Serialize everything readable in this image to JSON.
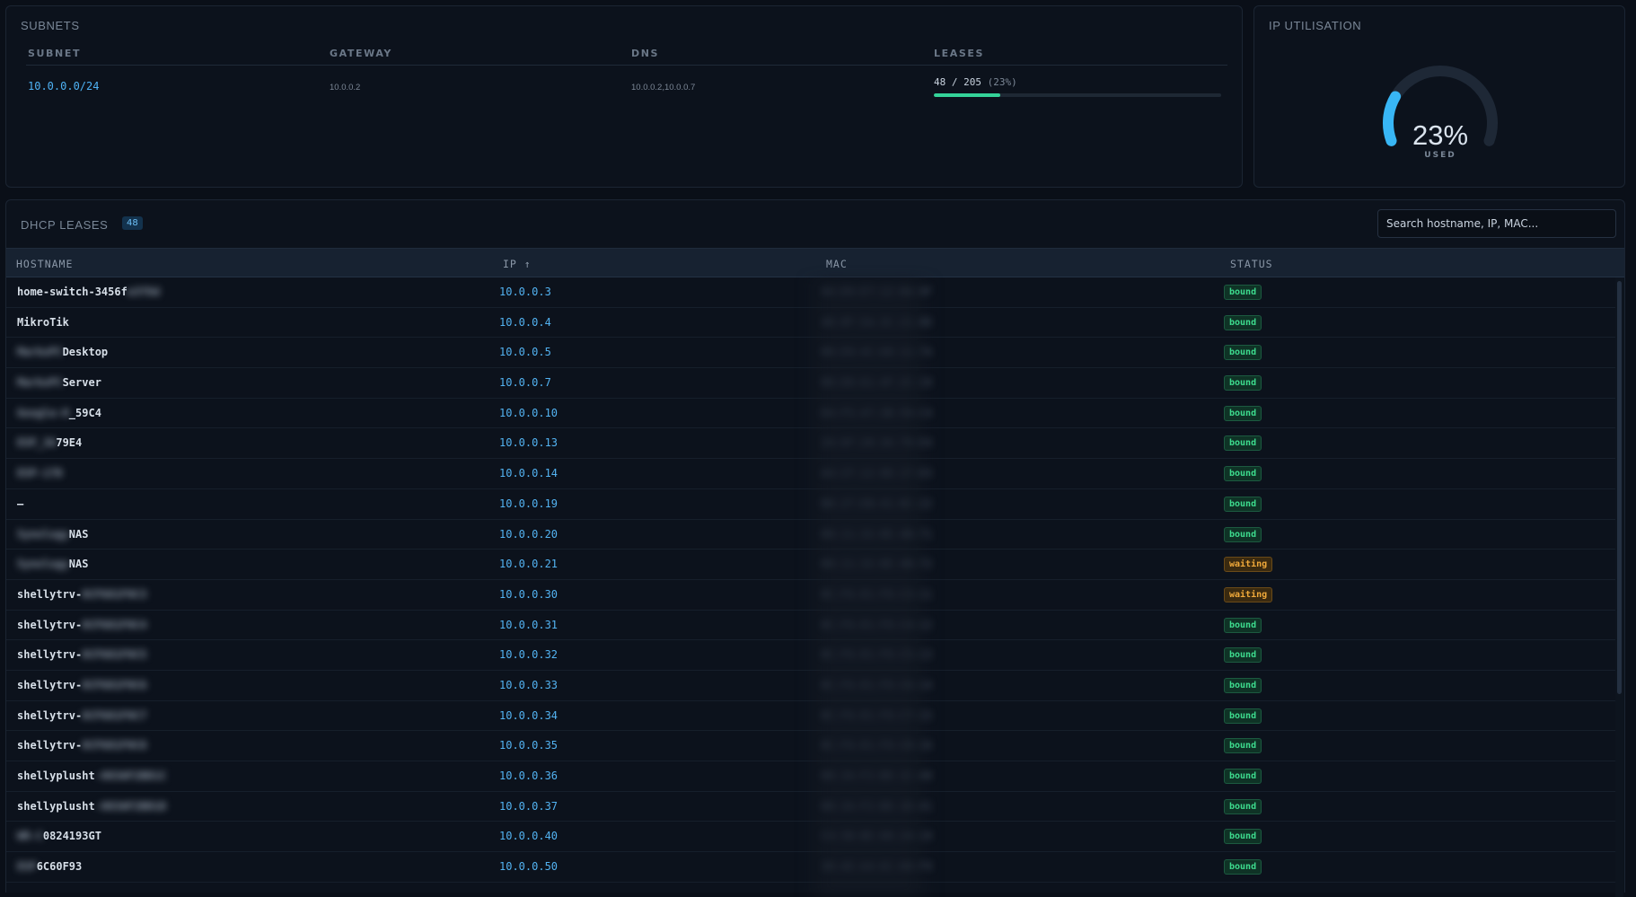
{
  "subnets": {
    "title": "SUBNETS",
    "columns": [
      "SUBNET",
      "GATEWAY",
      "DNS",
      "LEASES"
    ],
    "row": {
      "subnet": "10.0.0.0/24",
      "gateway": "10.0.0.2",
      "dns": "10.0.0.2,10.0.0.7",
      "leases_count": "48 / 205",
      "leases_pct": "(23%)",
      "leases_fraction": 0.23
    }
  },
  "utilisation": {
    "title": "IP UTILISATION",
    "value": "23%",
    "label": "USED",
    "fraction": 0.23,
    "accent": "#38b6f5",
    "track": "#1e2836"
  },
  "leases": {
    "title": "DHCP LEASES",
    "count": "48",
    "search_placeholder": "Search hostname, IP, MAC...",
    "columns": {
      "hostname": "HOSTNAME",
      "ip": "IP ↑",
      "mac": "MAC",
      "status": "STATUS"
    },
    "status_colors": {
      "bound": "#3ddc8e",
      "waiting": "#f0a93a"
    },
    "rows": [
      {
        "host": "home-switch-3456f",
        "host_blur": "e3f8d",
        "ip": "10.0.0.3",
        "mac": "44:D9:E7:12:8A:9F",
        "status": "bound"
      },
      {
        "host": "MikroTik",
        "host_blur": "",
        "ip": "10.0.0.4",
        "mac": "48:8F:5A:3C:21:0D",
        "status": "bound"
      },
      {
        "host_blur_pre": "MarkoPC",
        "host": "Desktop",
        "ip": "10.0.0.5",
        "mac": "00:E0:4C:68:11:7A",
        "status": "bound"
      },
      {
        "host_blur_pre": "MarkoPC",
        "host": "Server",
        "ip": "10.0.0.7",
        "mac": "00:D8:61:4F:2C:19",
        "status": "bound"
      },
      {
        "host_blur_pre": "Google-H",
        "host": "_59C4",
        "ip": "10.0.0.10",
        "mac": "D4:F5:47:3B:59:C4",
        "status": "bound"
      },
      {
        "host_blur_pre": "ESP_3A",
        "host": "79E4",
        "ip": "10.0.0.13",
        "mac": "24:6F:28:3A:79:E4",
        "status": "bound"
      },
      {
        "host_blur_pre": "ESP-17D",
        "host": "",
        "ip": "10.0.0.14",
        "mac": "A4:CF:12:9D:17:D3",
        "status": "bound"
      },
      {
        "host": "—",
        "host_blur": "",
        "ip": "10.0.0.19",
        "mac": "B8:27:EB:41:0C:22",
        "status": "bound"
      },
      {
        "host_blur_pre": "Synology",
        "host": "NAS",
        "ip": "10.0.0.20",
        "mac": "00:11:32:8E:4B:71",
        "status": "bound"
      },
      {
        "host_blur_pre": "Synology",
        "host": "NAS",
        "ip": "10.0.0.21",
        "mac": "00:11:32:8E:4B:72",
        "status": "waiting"
      },
      {
        "host": "shellytrv-",
        "host_blur": "8CF681F0C3",
        "ip": "10.0.0.30",
        "mac": "8C:F6:81:F0:C3:11",
        "status": "waiting"
      },
      {
        "host": "shellytrv-",
        "host_blur": "8CF681F0C4",
        "ip": "10.0.0.31",
        "mac": "8C:F6:81:F0:C4:12",
        "status": "bound"
      },
      {
        "host": "shellytrv-",
        "host_blur": "8CF681F0C5",
        "ip": "10.0.0.32",
        "mac": "8C:F6:81:F0:C5:13",
        "status": "bound"
      },
      {
        "host": "shellytrv-",
        "host_blur": "8CF681F0C6",
        "ip": "10.0.0.33",
        "mac": "8C:F6:81:F0:C6:14",
        "status": "bound"
      },
      {
        "host": "shellytrv-",
        "host_blur": "8CF681F0C7",
        "ip": "10.0.0.34",
        "mac": "8C:F6:81:F0:C7:15",
        "status": "bound"
      },
      {
        "host": "shellytrv-",
        "host_blur": "8CF681F0C8",
        "ip": "10.0.0.35",
        "mac": "8C:F6:81:F0:C8:16",
        "status": "bound"
      },
      {
        "host": "shellyplusht",
        "host_blur": "-083AF2BD1C",
        "ip": "10.0.0.36",
        "mac": "08:3A:F2:BD:1C:40",
        "status": "bound"
      },
      {
        "host": "shellyplusht",
        "host_blur": "-083AF2BD1D",
        "ip": "10.0.0.37",
        "mac": "08:3A:F2:BD:1D:41",
        "status": "bound"
      },
      {
        "host_blur_pre": "WR-C",
        "host": "0824193GT",
        "ip": "10.0.0.40",
        "mac": "C4:5B:BE:08:24:19",
        "status": "bound"
      },
      {
        "host_blur_pre": "ESP",
        "host": "6C60F93",
        "ip": "10.0.0.50",
        "mac": "30:AE:A4:6C:60:F9",
        "status": "bound"
      }
    ]
  }
}
